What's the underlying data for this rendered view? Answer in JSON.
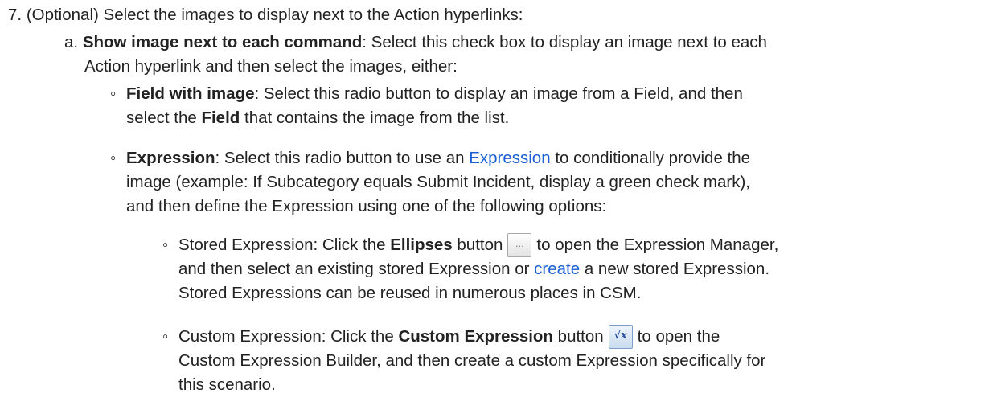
{
  "step7": {
    "num": "7.",
    "text": "(Optional) Select the images to display next to the Action hyperlinks:"
  },
  "item_a": {
    "letter": "a.",
    "bold": "Show image next to each command",
    "rest1": ": Select this check box to display an image next to each",
    "line2": "Action hyperlink and then select the images, either:"
  },
  "field_with_image": {
    "bullet": "◦",
    "bold": "Field with image",
    "rest1": ": Select this radio button to display an image from a Field, and then",
    "line2_pre": "select the ",
    "line2_bold": "Field",
    "line2_post": " that contains the image from the list."
  },
  "expression": {
    "bullet": "◦",
    "bold": "Expression",
    "pre_link": ": Select this radio button to use an ",
    "link": "Expression",
    "post_link": " to conditionally provide the",
    "line2": "image (example: If Subcategory equals Submit Incident, display a green check mark),",
    "line3": "and then define the Expression using one of the following options:"
  },
  "stored_expression": {
    "bullet": "◦",
    "pre": "Stored Expression: Click the ",
    "bold": "Ellipses",
    "post_bold": " button",
    "post_btn": "to open the Expression Manager,",
    "line2_pre": "and then select an existing stored Expression or ",
    "line2_link": "create",
    "line2_post": " a new stored Expression.",
    "line3": "Stored Expressions can be reused in numerous places in CSM.",
    "button_icon": "ellipsis-button-icon",
    "button_glyph": "..."
  },
  "custom_expression": {
    "bullet": "◦",
    "pre": "Custom Expression: Click the ",
    "bold": "Custom Expression",
    "post_bold": " button",
    "post_btn": "to open the",
    "line2": "Custom Expression Builder, and then create a custom Expression specifically for",
    "line3": "this scenario.",
    "button_icon": "function-fx-button-icon",
    "button_glyph": "√x"
  },
  "colors": {
    "text": "#222222",
    "link": "#1a5fd6"
  }
}
